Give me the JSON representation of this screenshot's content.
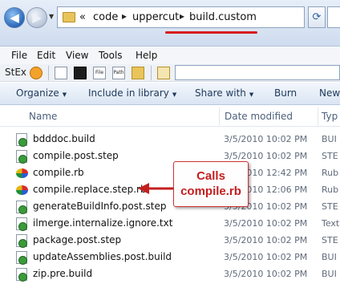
{
  "address": {
    "overflow_glyph": "«",
    "crumbs": [
      "code",
      "uppercut",
      "build.custom"
    ],
    "separator": "▸",
    "refresh_glyph": "⟳"
  },
  "menu": [
    "File",
    "Edit",
    "View",
    "Tools",
    "Help"
  ],
  "stex": {
    "label": "StEx",
    "icon_labels": [
      "File",
      "Path"
    ]
  },
  "commands": {
    "organize": "Organize",
    "include": "Include in library",
    "share": "Share with",
    "burn": "Burn",
    "new": "New"
  },
  "columns": {
    "name": "Name",
    "date": "Date modified",
    "type": "Typ"
  },
  "files": [
    {
      "name": "bdddoc.build",
      "date": "3/5/2010 10:02 PM",
      "type": "BUI",
      "icon": "build-icon"
    },
    {
      "name": "compile.post.step",
      "date": "3/5/2010 10:02 PM",
      "type": "STE",
      "icon": "build-icon"
    },
    {
      "name": "compile.rb",
      "date": "3/6/2010 12:42 PM",
      "type": "Rub",
      "icon": "ruby-icon"
    },
    {
      "name": "compile.replace.step.rb",
      "date": "3/6/2010 12:06 PM",
      "type": "Rub",
      "icon": "ruby-icon"
    },
    {
      "name": "generateBuildInfo.post.step",
      "date": "3/5/2010 10:02 PM",
      "type": "STE",
      "icon": "build-icon"
    },
    {
      "name": "ilmerge.internalize.ignore.txt",
      "date": "3/5/2010 10:02 PM",
      "type": "Text",
      "icon": "build-icon"
    },
    {
      "name": "package.post.step",
      "date": "3/5/2010 10:02 PM",
      "type": "STE",
      "icon": "build-icon"
    },
    {
      "name": "updateAssemblies.post.build",
      "date": "3/5/2010 10:02 PM",
      "type": "BUI",
      "icon": "build-icon"
    },
    {
      "name": "zip.pre.build",
      "date": "3/5/2010 10:02 PM",
      "type": "BUI",
      "icon": "build-icon"
    }
  ],
  "callout": {
    "line1": "Calls",
    "line2": "compile.rb",
    "color": "#c41f1f"
  }
}
